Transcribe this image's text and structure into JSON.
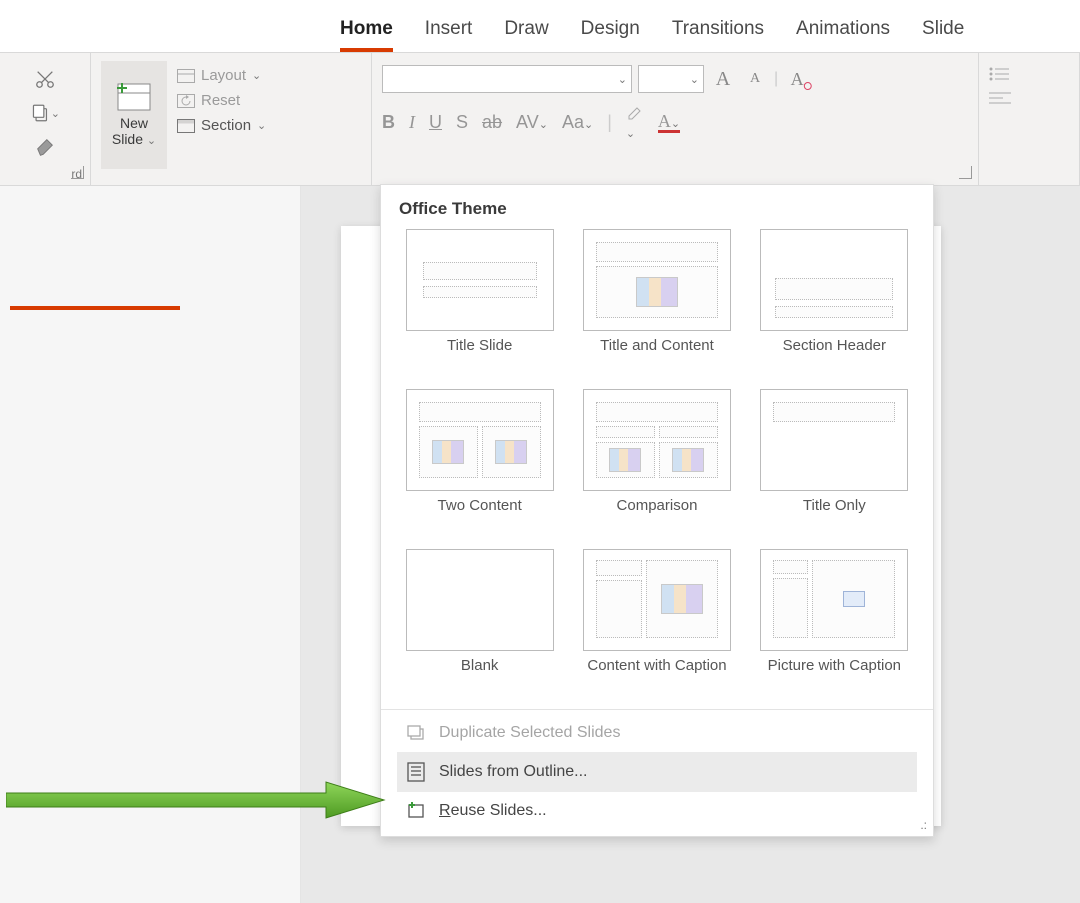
{
  "tabs": {
    "items": [
      "Home",
      "Insert",
      "Draw",
      "Design",
      "Transitions",
      "Animations",
      "Slide"
    ],
    "active_index": 0
  },
  "ribbon": {
    "clipboard": {
      "label": "rd"
    },
    "slides": {
      "new_slide_btn": {
        "line1": "New",
        "line2": "Slide"
      },
      "layout": "Layout",
      "reset": "Reset",
      "section": "Section"
    },
    "font": {
      "bold": "B",
      "italic": "I",
      "underline": "U",
      "shadow": "S",
      "strike": "ab",
      "spacing": "AV",
      "changecase": "Aa",
      "incA": "A",
      "decA": "A",
      "clear": "A"
    }
  },
  "dropdown": {
    "title": "Office Theme",
    "layouts": [
      {
        "id": "title",
        "label": "Title Slide"
      },
      {
        "id": "title-content",
        "label": "Title and Content"
      },
      {
        "id": "section",
        "label": "Section Header"
      },
      {
        "id": "two-content",
        "label": "Two Content"
      },
      {
        "id": "comparison",
        "label": "Comparison"
      },
      {
        "id": "title-only",
        "label": "Title Only"
      },
      {
        "id": "blank",
        "label": "Blank"
      },
      {
        "id": "content-caption",
        "label": "Content with Caption"
      },
      {
        "id": "picture-caption",
        "label": "Picture with Caption"
      }
    ],
    "actions": {
      "duplicate": "Duplicate Selected Slides",
      "outline": "Slides from Outline...",
      "reuse": "Reuse Slides..."
    }
  }
}
